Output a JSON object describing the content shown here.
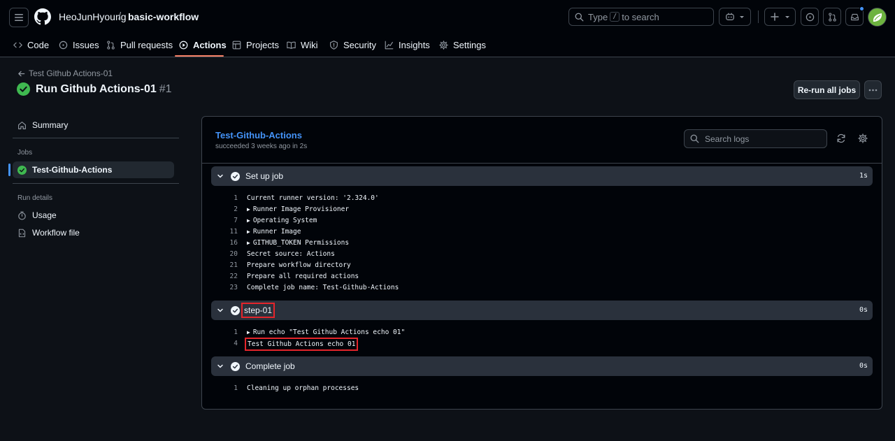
{
  "header": {
    "owner": "HeoJunHyoung",
    "separator": "/",
    "repo": "basic-workflow",
    "search": {
      "prefix": "Type",
      "key": "/",
      "suffix": "to search"
    }
  },
  "repo_nav": {
    "items": [
      {
        "label": "Code",
        "icon": "code-icon"
      },
      {
        "label": "Issues",
        "icon": "issue-icon"
      },
      {
        "label": "Pull requests",
        "icon": "pull-request-icon"
      },
      {
        "label": "Actions",
        "icon": "play-icon",
        "active": true
      },
      {
        "label": "Projects",
        "icon": "table-icon"
      },
      {
        "label": "Wiki",
        "icon": "book-icon"
      },
      {
        "label": "Security",
        "icon": "shield-icon"
      },
      {
        "label": "Insights",
        "icon": "graph-icon"
      },
      {
        "label": "Settings",
        "icon": "gear-icon"
      }
    ]
  },
  "run": {
    "back_label": "Test Github Actions-01",
    "title": "Run Github Actions-01",
    "number": "#1",
    "rerun_label": "Re-run all jobs"
  },
  "sidebar": {
    "summary": "Summary",
    "jobs_heading": "Jobs",
    "job": "Test-Github-Actions",
    "details_heading": "Run details",
    "usage": "Usage",
    "workflow_file": "Workflow file"
  },
  "job": {
    "name": "Test-Github-Actions",
    "meta": "succeeded 3 weeks ago in 2s",
    "search_placeholder": "Search logs"
  },
  "steps": [
    {
      "name": "Set up job",
      "time": "1s",
      "lines": [
        {
          "n": "1",
          "text": "Current runner version: '2.324.0'"
        },
        {
          "n": "2",
          "text": "Runner Image Provisioner",
          "collapsed": true
        },
        {
          "n": "7",
          "text": "Operating System",
          "collapsed": true
        },
        {
          "n": "11",
          "text": "Runner Image",
          "collapsed": true
        },
        {
          "n": "16",
          "text": "GITHUB_TOKEN Permissions",
          "collapsed": true
        },
        {
          "n": "20",
          "text": "Secret source: Actions"
        },
        {
          "n": "21",
          "text": "Prepare workflow directory"
        },
        {
          "n": "22",
          "text": "Prepare all required actions"
        },
        {
          "n": "23",
          "text": "Complete job name: Test-Github-Actions"
        }
      ]
    },
    {
      "name": "step-01",
      "time": "0s",
      "lines": [
        {
          "n": "1",
          "text": "Run echo \"Test Github Actions echo 01\"",
          "collapsed": true
        },
        {
          "n": "4",
          "text": "Test Github Actions echo 01"
        }
      ]
    },
    {
      "name": "Complete job",
      "time": "0s",
      "lines": [
        {
          "n": "1",
          "text": "Cleaning up orphan processes"
        }
      ]
    }
  ],
  "colors": {
    "bg": "#0d1117",
    "header_bg": "#010409",
    "accent_link": "#4493f8",
    "success": "#3fb950",
    "highlight_box": "#e5252b",
    "active_tab_underline": "#f78166"
  }
}
